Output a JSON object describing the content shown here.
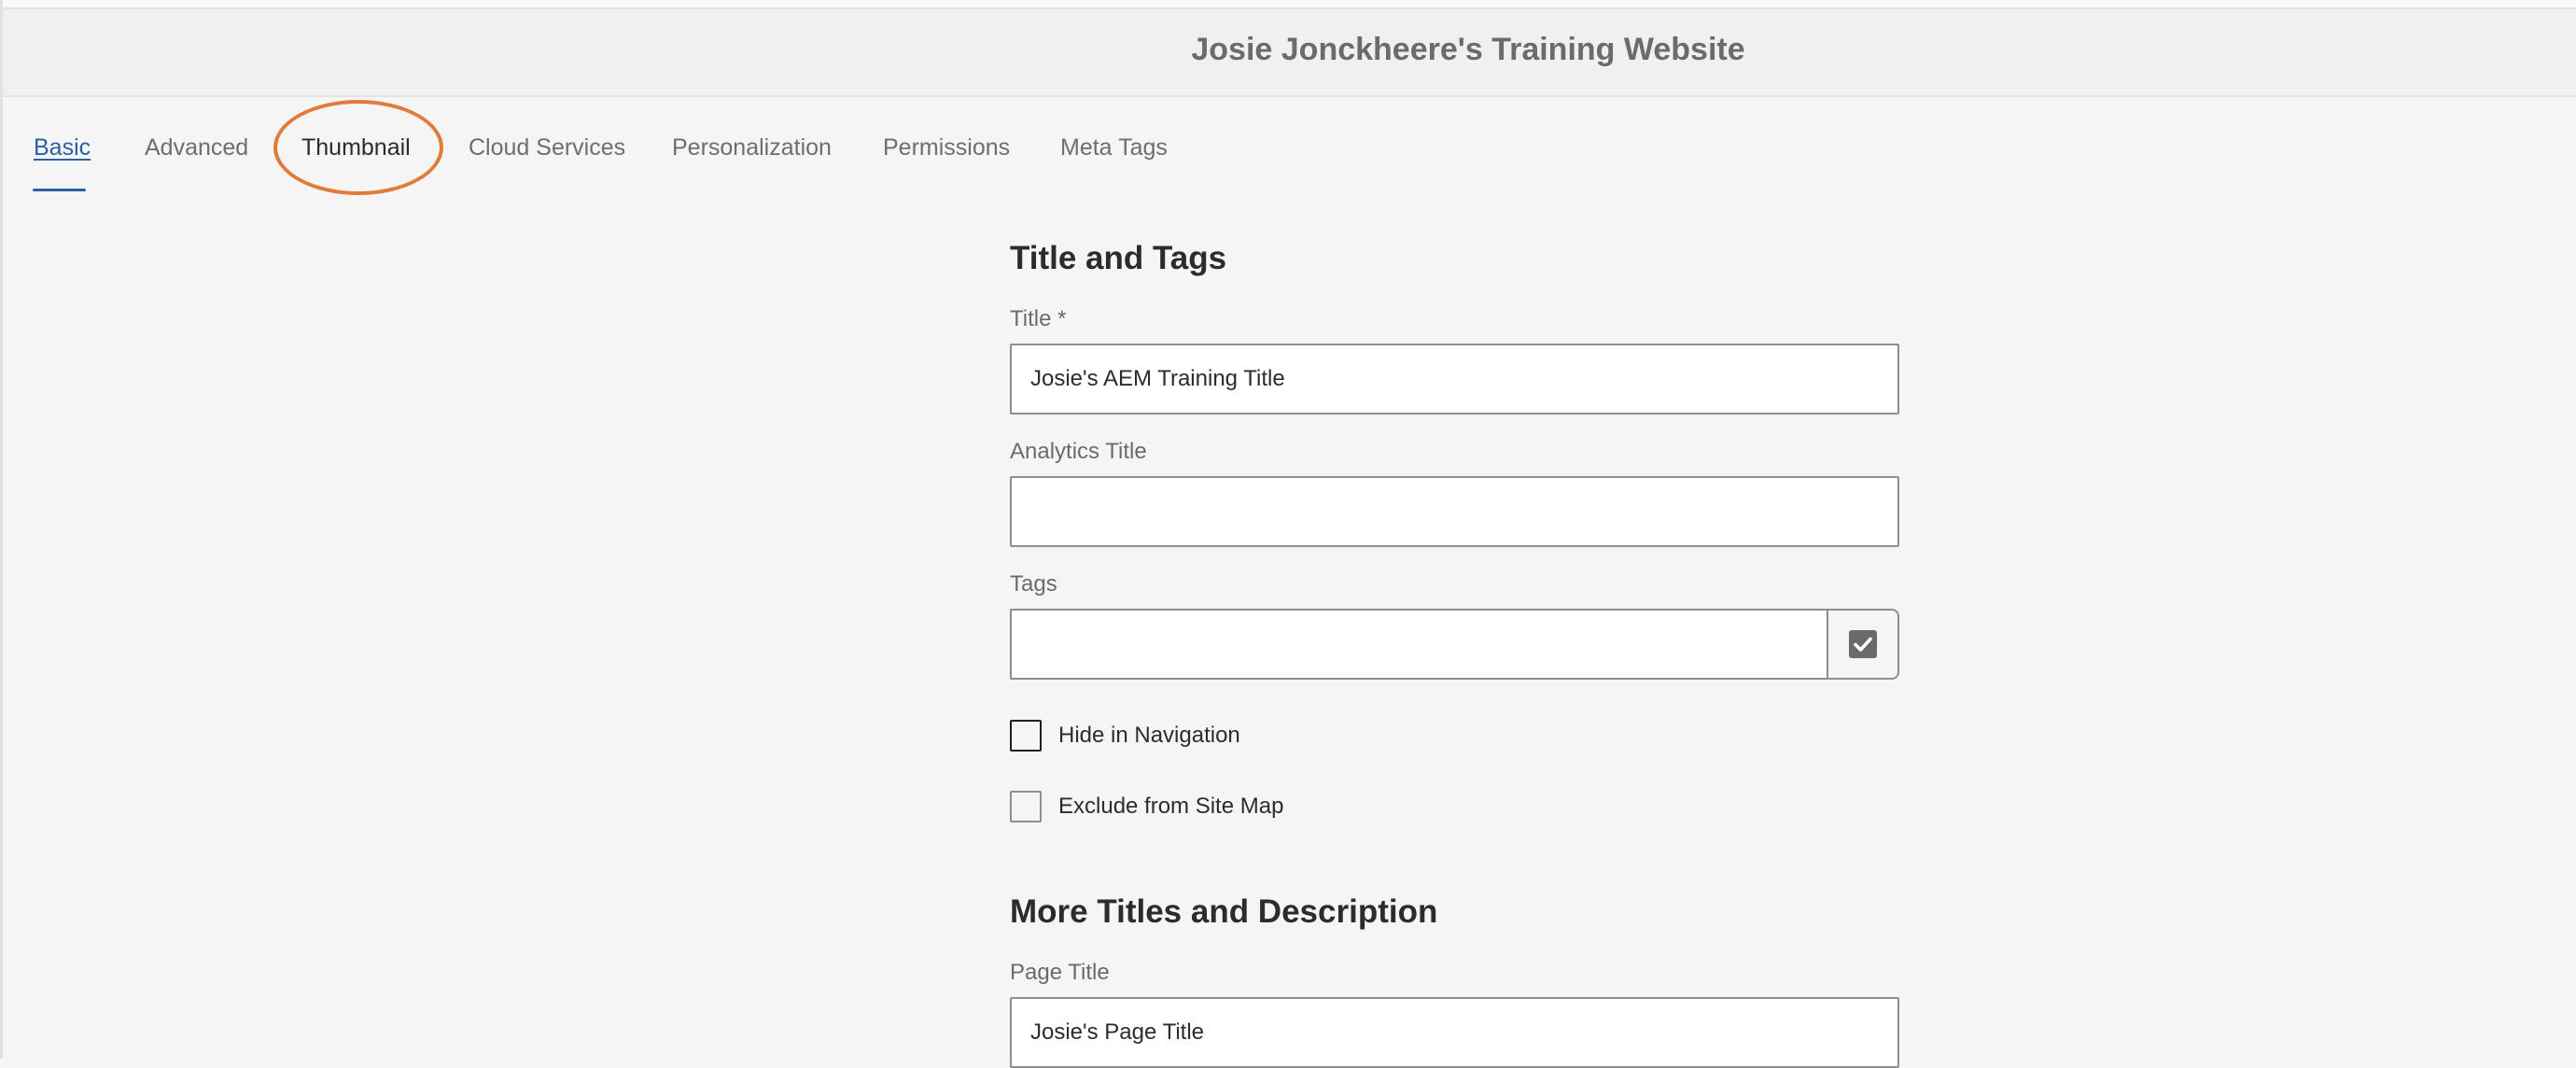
{
  "header": {
    "title": "Josie Jonckheere's Training Website"
  },
  "tabs": [
    {
      "label": "Basic",
      "active": true
    },
    {
      "label": "Advanced"
    },
    {
      "label": "Thumbnail",
      "highlighted": true
    },
    {
      "label": "Cloud Services"
    },
    {
      "label": "Personalization"
    },
    {
      "label": "Permissions"
    },
    {
      "label": "Meta Tags"
    }
  ],
  "form": {
    "title_and_tags": {
      "heading": "Title and Tags",
      "title_label": "Title *",
      "title_value": "Josie's AEM Training Title",
      "analytics_title_label": "Analytics Title",
      "analytics_title_value": "",
      "tags_label": "Tags",
      "tags_value": "",
      "hide_in_navigation_label": "Hide in Navigation",
      "hide_in_navigation_checked": false,
      "exclude_from_site_map_label": "Exclude from Site Map",
      "exclude_from_site_map_checked": false
    },
    "more_titles": {
      "heading": "More Titles and Description",
      "page_title_label": "Page Title",
      "page_title_value": "Josie's Page Title"
    }
  },
  "colors": {
    "active_tab": "#2b61a4",
    "highlight_ring": "#e27b39",
    "background": "#f5f5f5"
  },
  "icons": {
    "tags_picker": "checkbox-check-icon"
  }
}
